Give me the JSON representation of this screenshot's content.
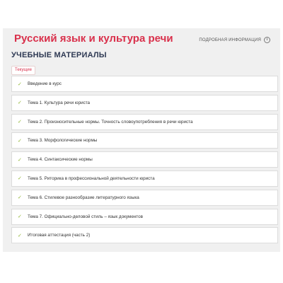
{
  "header": {
    "course_title": "Русский язык и культура речи",
    "details_link": "ПОДРОБНАЯ ИНФОРМАЦИЯ",
    "info_icon_glyph": "i"
  },
  "section": {
    "title": "УЧЕБНЫЕ МАТЕРИАЛЫ",
    "filter_tag": "Текущие"
  },
  "materials": [
    {
      "label": "Введение в курс",
      "icon": "checkmark-icon",
      "check": "✓"
    },
    {
      "label": "Тема 1. Культура речи юриста",
      "icon": "checkmark-icon",
      "check": "✓"
    },
    {
      "label": "Тема 2. Произносительные нормы. Точность словоупотребления в речи юриста",
      "icon": "checkmark-icon",
      "check": "✓"
    },
    {
      "label": "Тема 3. Морфологические нормы",
      "icon": "checkmark-icon",
      "check": "✓"
    },
    {
      "label": "Тема 4. Синтаксические нормы",
      "icon": "checkmark-icon",
      "check": "✓"
    },
    {
      "label": "Тема 5. Риторика в профессиональной деятельности юриста",
      "icon": "checkmark-icon",
      "check": "✓"
    },
    {
      "label": "Тема 6. Стилевое разнообразие литературного языка",
      "icon": "checkmark-icon",
      "check": "✓"
    },
    {
      "label": "Тема 7. Официально-деловой стиль – язык документов",
      "icon": "checkmark-icon",
      "check": "✓"
    },
    {
      "label": "Итоговая аттестация (часть 2)",
      "icon": "checkmark-icon",
      "check": "✓"
    }
  ],
  "colors": {
    "title_accent": "#d9304b",
    "section_title": "#2f3a54",
    "check_green": "#8fb531",
    "panel_bg": "#f0f0f0"
  }
}
